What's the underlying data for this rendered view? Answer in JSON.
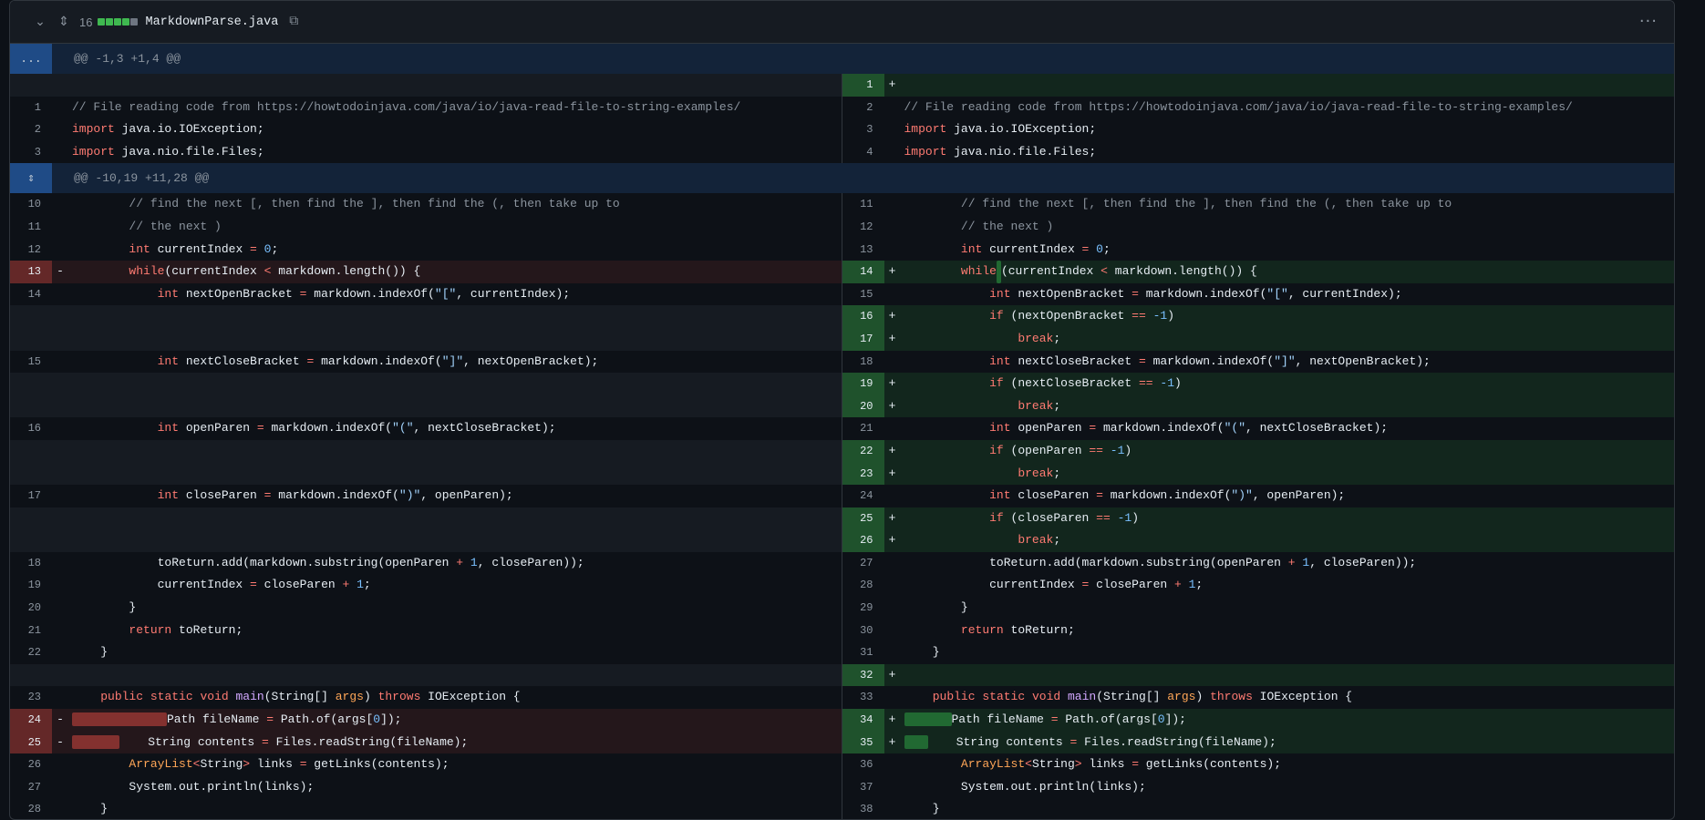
{
  "file": {
    "changes_count": "16",
    "name": "MarkdownParse.java",
    "diffstat": [
      "#3fb950",
      "#3fb950",
      "#3fb950",
      "#3fb950",
      "#6e7681"
    ]
  },
  "hunks": [
    {
      "label": "@@ -1,3 +1,4 @@",
      "gutter": "..."
    },
    {
      "label": "@@ -10,19 +11,28 @@",
      "gutter": "expand"
    }
  ],
  "rows": [
    {
      "type": "hunk",
      "hunk": 0
    },
    {
      "type": "line",
      "left": {
        "kind": "blank"
      },
      "right": {
        "kind": "add",
        "num": "1",
        "code": ""
      }
    },
    {
      "type": "line",
      "left": {
        "kind": "ctx",
        "num": "1",
        "code": "// File reading code from https://howtodoinjava.com/java/io/java-read-file-to-string-examples/"
      },
      "right": {
        "kind": "ctx",
        "num": "2",
        "code": "// File reading code from https://howtodoinjava.com/java/io/java-read-file-to-string-examples/"
      }
    },
    {
      "type": "line",
      "left": {
        "kind": "ctx",
        "num": "2",
        "code": "import java.io.IOException;"
      },
      "right": {
        "kind": "ctx",
        "num": "3",
        "code": "import java.io.IOException;"
      }
    },
    {
      "type": "line",
      "left": {
        "kind": "ctx",
        "num": "3",
        "code": "import java.nio.file.Files;"
      },
      "right": {
        "kind": "ctx",
        "num": "4",
        "code": "import java.nio.file.Files;"
      }
    },
    {
      "type": "hunk",
      "hunk": 1
    },
    {
      "type": "line",
      "left": {
        "kind": "ctx",
        "num": "10",
        "code": "        // find the next [, then find the ], then find the (, then take up to"
      },
      "right": {
        "kind": "ctx",
        "num": "11",
        "code": "        // find the next [, then find the ], then find the (, then take up to"
      }
    },
    {
      "type": "line",
      "left": {
        "kind": "ctx",
        "num": "11",
        "code": "        // the next )"
      },
      "right": {
        "kind": "ctx",
        "num": "12",
        "code": "        // the next )"
      }
    },
    {
      "type": "line",
      "left": {
        "kind": "ctx",
        "num": "12",
        "code": "        int currentIndex = 0;"
      },
      "right": {
        "kind": "ctx",
        "num": "13",
        "code": "        int currentIndex = 0;"
      }
    },
    {
      "type": "line",
      "left": {
        "kind": "del",
        "num": "13",
        "code": "        while(currentIndex < markdown.length()) {"
      },
      "right": {
        "kind": "add",
        "num": "14",
        "code": "        while (currentIndex < markdown.length()) {"
      }
    },
    {
      "type": "line",
      "left": {
        "kind": "ctx",
        "num": "14",
        "code": "            int nextOpenBracket = markdown.indexOf(\"[\", currentIndex);"
      },
      "right": {
        "kind": "ctx",
        "num": "15",
        "code": "            int nextOpenBracket = markdown.indexOf(\"[\", currentIndex);"
      }
    },
    {
      "type": "line",
      "left": {
        "kind": "blank"
      },
      "right": {
        "kind": "add",
        "num": "16",
        "code": "            if (nextOpenBracket == -1)"
      }
    },
    {
      "type": "line",
      "left": {
        "kind": "blank"
      },
      "right": {
        "kind": "add",
        "num": "17",
        "code": "                break;"
      }
    },
    {
      "type": "line",
      "left": {
        "kind": "ctx",
        "num": "15",
        "code": "            int nextCloseBracket = markdown.indexOf(\"]\", nextOpenBracket);"
      },
      "right": {
        "kind": "ctx",
        "num": "18",
        "code": "            int nextCloseBracket = markdown.indexOf(\"]\", nextOpenBracket);"
      }
    },
    {
      "type": "line",
      "left": {
        "kind": "blank"
      },
      "right": {
        "kind": "add",
        "num": "19",
        "code": "            if (nextCloseBracket == -1)"
      }
    },
    {
      "type": "line",
      "left": {
        "kind": "blank"
      },
      "right": {
        "kind": "add",
        "num": "20",
        "code": "                break;"
      }
    },
    {
      "type": "line",
      "left": {
        "kind": "ctx",
        "num": "16",
        "code": "            int openParen = markdown.indexOf(\"(\", nextCloseBracket);"
      },
      "right": {
        "kind": "ctx",
        "num": "21",
        "code": "            int openParen = markdown.indexOf(\"(\", nextCloseBracket);"
      }
    },
    {
      "type": "line",
      "left": {
        "kind": "blank"
      },
      "right": {
        "kind": "add",
        "num": "22",
        "code": "            if (openParen == -1)"
      }
    },
    {
      "type": "line",
      "left": {
        "kind": "blank"
      },
      "right": {
        "kind": "add",
        "num": "23",
        "code": "                break;"
      }
    },
    {
      "type": "line",
      "left": {
        "kind": "ctx",
        "num": "17",
        "code": "            int closeParen = markdown.indexOf(\")\", openParen);"
      },
      "right": {
        "kind": "ctx",
        "num": "24",
        "code": "            int closeParen = markdown.indexOf(\")\", openParen);"
      }
    },
    {
      "type": "line",
      "left": {
        "kind": "blank"
      },
      "right": {
        "kind": "add",
        "num": "25",
        "code": "            if (closeParen == -1)"
      }
    },
    {
      "type": "line",
      "left": {
        "kind": "blank"
      },
      "right": {
        "kind": "add",
        "num": "26",
        "code": "                break;"
      }
    },
    {
      "type": "line",
      "left": {
        "kind": "ctx",
        "num": "18",
        "code": "            toReturn.add(markdown.substring(openParen + 1, closeParen));"
      },
      "right": {
        "kind": "ctx",
        "num": "27",
        "code": "            toReturn.add(markdown.substring(openParen + 1, closeParen));"
      }
    },
    {
      "type": "line",
      "left": {
        "kind": "ctx",
        "num": "19",
        "code": "            currentIndex = closeParen + 1;"
      },
      "right": {
        "kind": "ctx",
        "num": "28",
        "code": "            currentIndex = closeParen + 1;"
      }
    },
    {
      "type": "line",
      "left": {
        "kind": "ctx",
        "num": "20",
        "code": "        }"
      },
      "right": {
        "kind": "ctx",
        "num": "29",
        "code": "        }"
      }
    },
    {
      "type": "line",
      "left": {
        "kind": "ctx",
        "num": "21",
        "code": "        return toReturn;"
      },
      "right": {
        "kind": "ctx",
        "num": "30",
        "code": "        return toReturn;"
      }
    },
    {
      "type": "line",
      "left": {
        "kind": "ctx",
        "num": "22",
        "code": "    }"
      },
      "right": {
        "kind": "ctx",
        "num": "31",
        "code": "    }"
      }
    },
    {
      "type": "line",
      "left": {
        "kind": "blank"
      },
      "right": {
        "kind": "add",
        "num": "32",
        "code": ""
      }
    },
    {
      "type": "line",
      "left": {
        "kind": "ctx",
        "num": "23",
        "code": "    public static void main(String[] args) throws IOException {"
      },
      "right": {
        "kind": "ctx",
        "num": "33",
        "code": "    public static void main(String[] args) throws IOException {"
      }
    },
    {
      "type": "line",
      "left": {
        "kind": "del",
        "num": "24",
        "code": "        Path fileName = Path.of(args[0]);"
      },
      "right": {
        "kind": "add",
        "num": "34",
        "code": "    Path fileName = Path.of(args[0]);"
      }
    },
    {
      "type": "line",
      "left": {
        "kind": "del",
        "num": "25",
        "code": "        String contents = Files.readString(fileName);"
      },
      "right": {
        "kind": "add",
        "num": "35",
        "code": "      String contents = Files.readString(fileName);"
      }
    },
    {
      "type": "line",
      "left": {
        "kind": "ctx",
        "num": "26",
        "code": "        ArrayList<String> links = getLinks(contents);"
      },
      "right": {
        "kind": "ctx",
        "num": "36",
        "code": "        ArrayList<String> links = getLinks(contents);"
      }
    },
    {
      "type": "line",
      "left": {
        "kind": "ctx",
        "num": "27",
        "code": "        System.out.println(links);"
      },
      "right": {
        "kind": "ctx",
        "num": "37",
        "code": "        System.out.println(links);"
      }
    },
    {
      "type": "line",
      "left": {
        "kind": "ctx",
        "num": "28",
        "code": "    }"
      },
      "right": {
        "kind": "ctx",
        "num": "38",
        "code": "    }"
      }
    }
  ]
}
